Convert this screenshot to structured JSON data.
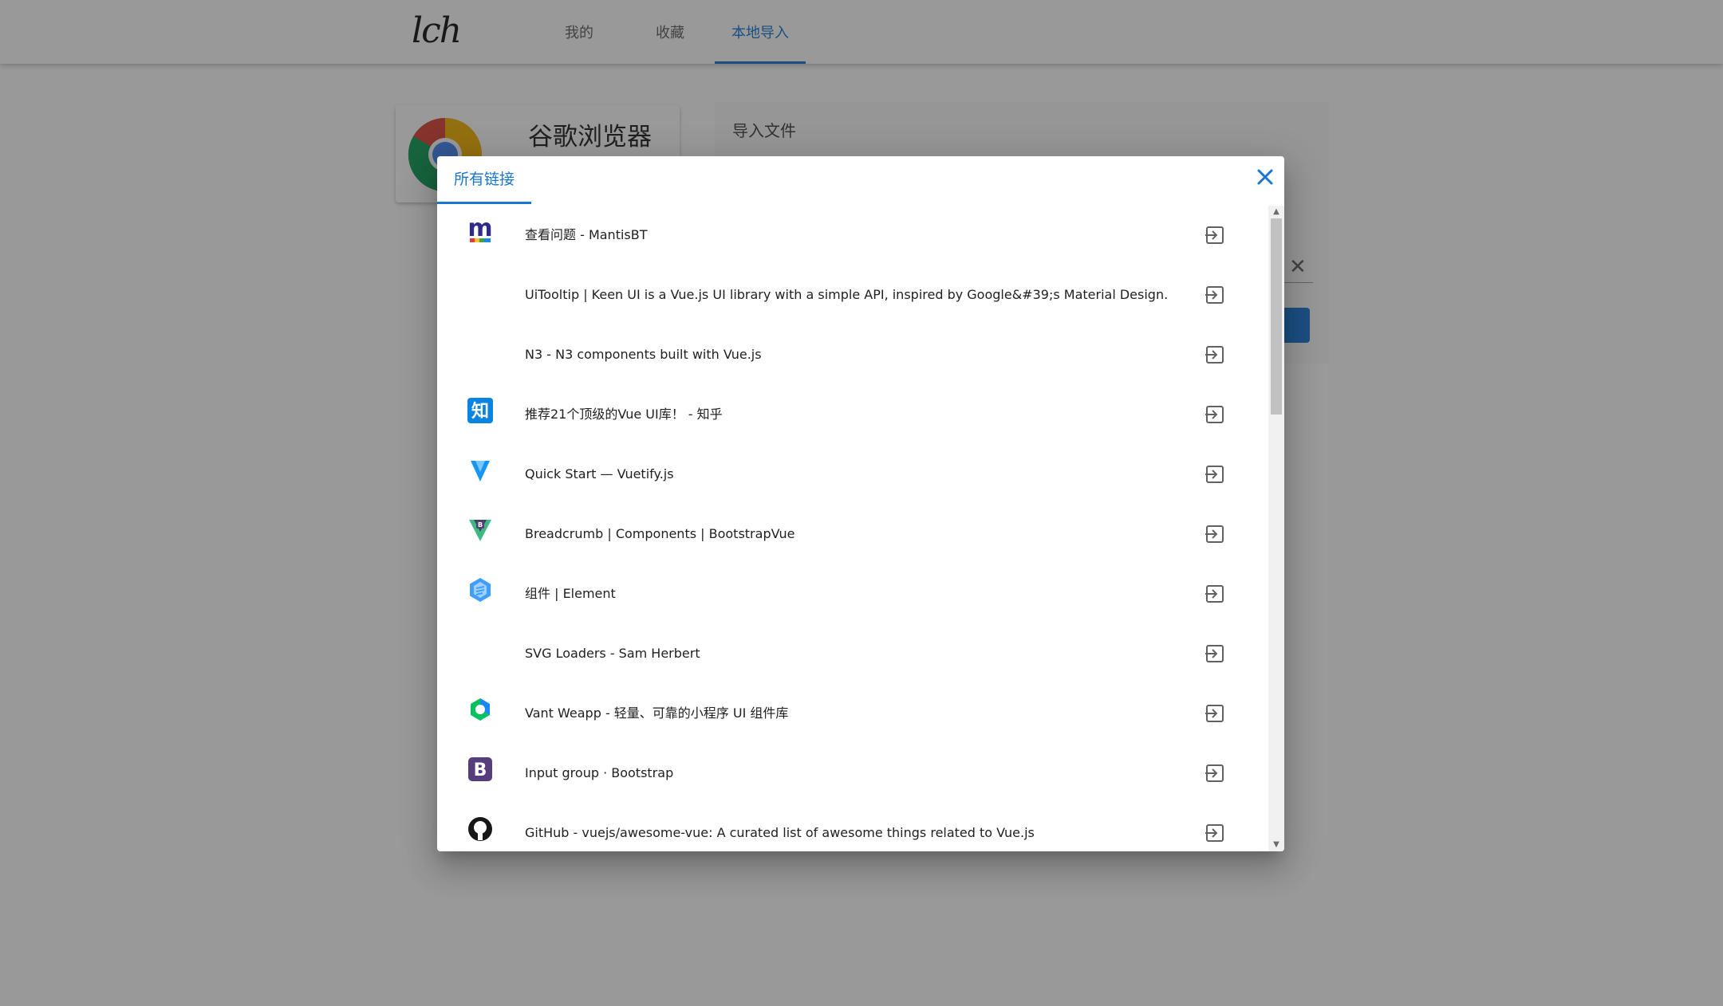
{
  "app": {
    "logo_text": "lch"
  },
  "nav": {
    "tabs": [
      {
        "label": "我的"
      },
      {
        "label": "收藏"
      },
      {
        "label": "本地导入",
        "active": true
      }
    ]
  },
  "browser_card": {
    "title": "谷歌浏览器",
    "icon": "chrome-logo-icon"
  },
  "import_panel": {
    "title": "导入文件"
  },
  "dialog": {
    "tab_label": "所有链接",
    "close_icon": "close-icon",
    "items": [
      {
        "title": "查看问题 - MantisBT",
        "favicon": "mantisbt-icon"
      },
      {
        "title": "UiTooltip | Keen UI is a Vue.js UI library with a simple API, inspired by Google&#39;s Material Design.",
        "favicon": ""
      },
      {
        "title": "N3 - N3 components built with Vue.js",
        "favicon": ""
      },
      {
        "title": "推荐21个顶级的Vue UI库！ - 知乎",
        "favicon": "zhihu-icon"
      },
      {
        "title": "Quick Start — Vuetify.js",
        "favicon": "vuetify-icon"
      },
      {
        "title": "Breadcrumb | Components | BootstrapVue",
        "favicon": "bootstrapvue-icon"
      },
      {
        "title": "组件 | Element",
        "favicon": "element-icon"
      },
      {
        "title": "SVG Loaders - Sam Herbert",
        "favicon": ""
      },
      {
        "title": "Vant Weapp - 轻量、可靠的小程序 UI 组件库",
        "favicon": "vant-icon"
      },
      {
        "title": "Input group · Bootstrap",
        "favicon": "bootstrap-icon"
      },
      {
        "title": "GitHub - vuejs/awesome-vue: A curated list of awesome things related to Vue.js",
        "favicon": "github-icon"
      }
    ],
    "item_action_icon": "open-in-icon"
  },
  "colors": {
    "accent": "#1976d2",
    "overlay": "rgba(33,33,33,0.46)",
    "background": "#ffffff"
  }
}
